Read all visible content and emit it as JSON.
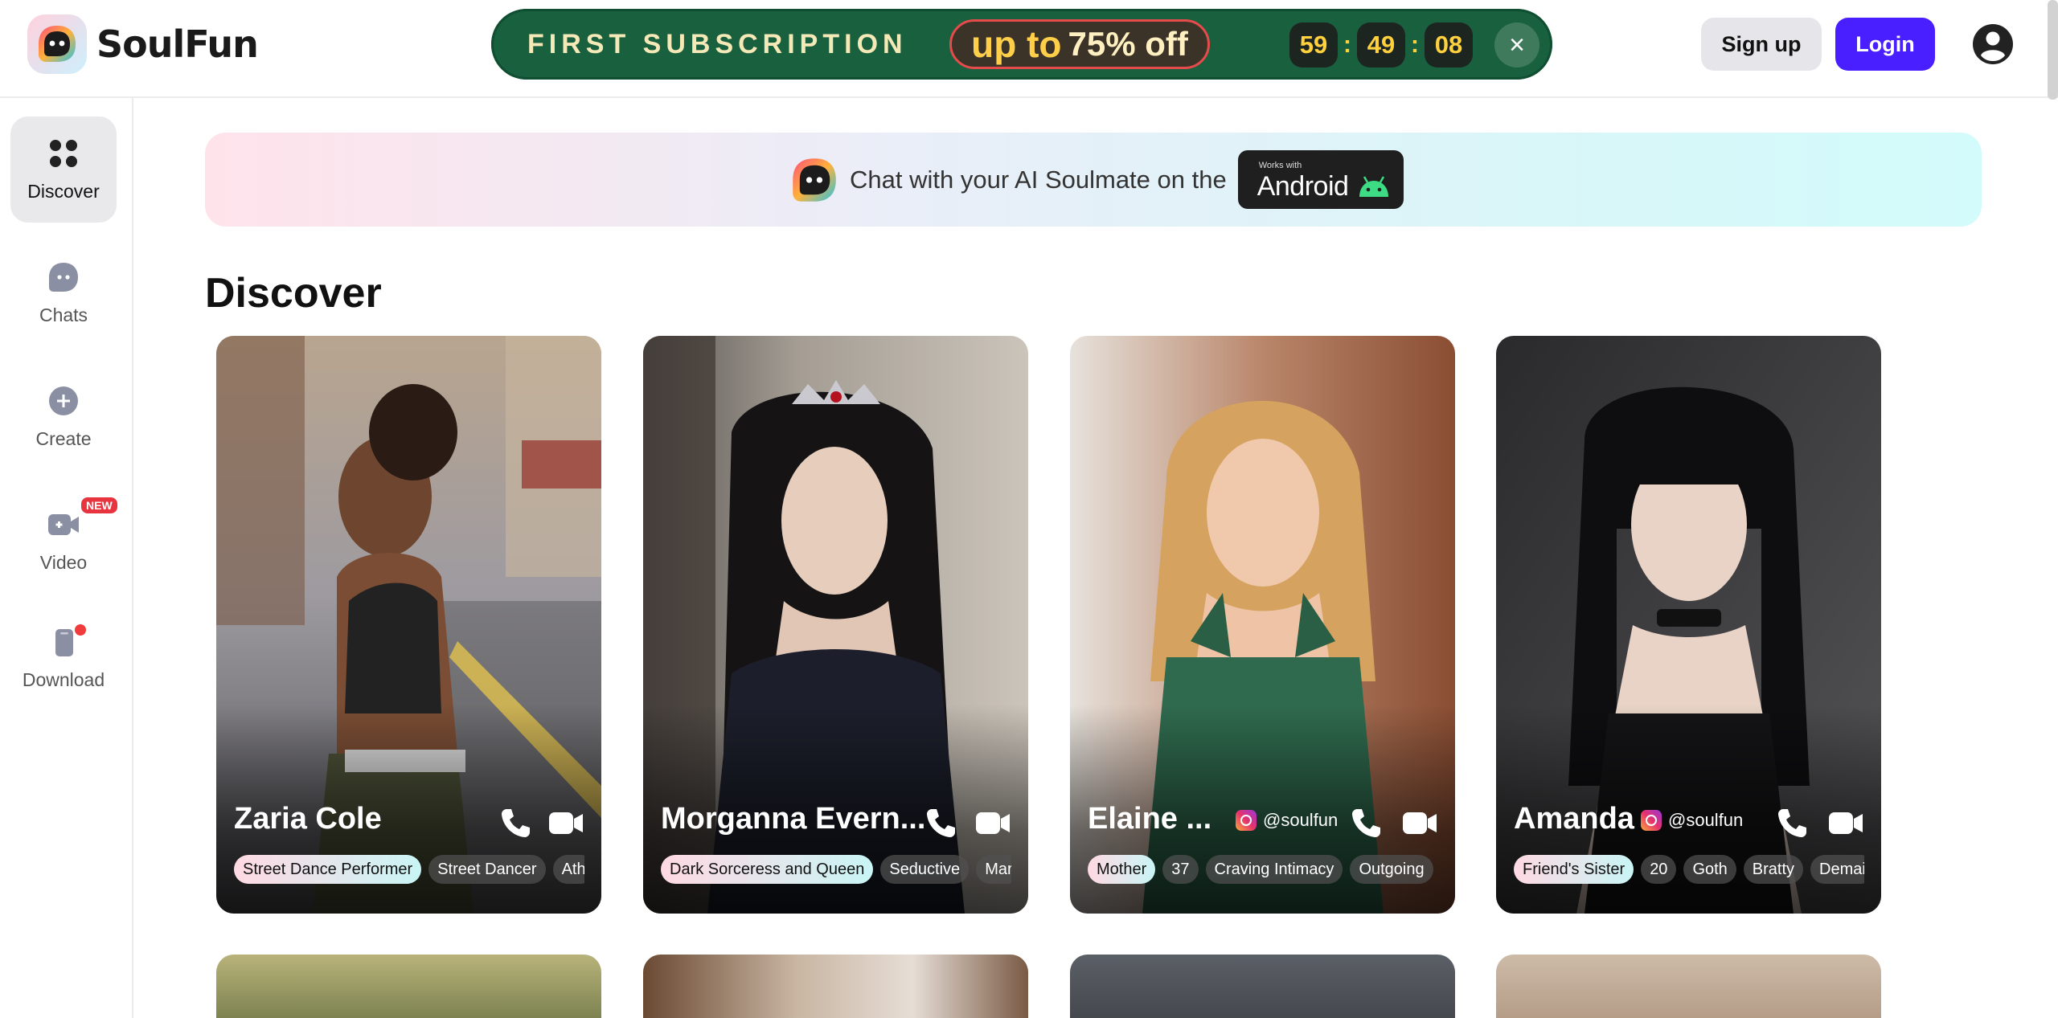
{
  "app": {
    "name": "SoulFun"
  },
  "promo": {
    "title": "FIRST SUBSCRIPTION",
    "offer_prefix": "up to",
    "offer_value": "75% off",
    "timer": {
      "hours": "59",
      "minutes": "49",
      "seconds": "08"
    },
    "close_label": "×"
  },
  "auth": {
    "signup_label": "Sign up",
    "login_label": "Login"
  },
  "sidebar": {
    "items": [
      {
        "label": "Discover",
        "icon": "grid-icon",
        "active": true
      },
      {
        "label": "Chats",
        "icon": "chat-icon"
      },
      {
        "label": "Create",
        "icon": "plus-circle-icon"
      },
      {
        "label": "Video",
        "icon": "video-camera-icon",
        "badge": "NEW"
      },
      {
        "label": "Download",
        "icon": "phone-download-icon",
        "dot": true
      }
    ]
  },
  "banner": {
    "text": "Chat with your AI Soulmate on the",
    "badge_small": "Works with",
    "badge_big": "Android"
  },
  "page": {
    "title": "Discover"
  },
  "cards": [
    {
      "name": "Zaria Cole",
      "handle": "",
      "tags": [
        "Street Dance Performer",
        "Street Dancer",
        "Ath"
      ]
    },
    {
      "name": "Morganna Evern...",
      "handle": "",
      "tags": [
        "Dark Sorceress and Queen",
        "Seductive",
        "Mar"
      ]
    },
    {
      "name": "Elaine ...",
      "handle": "@soulfun",
      "tags": [
        "Mother",
        "37",
        "Craving Intimacy",
        "Outgoing"
      ]
    },
    {
      "name": "Amanda",
      "handle": "@soulfun",
      "tags": [
        "Friend's Sister",
        "20",
        "Goth",
        "Bratty",
        "Demai"
      ]
    }
  ],
  "colors": {
    "promo_bg": "#19603f",
    "login_bg": "#4a1fff",
    "accent_red": "#e8343f"
  }
}
